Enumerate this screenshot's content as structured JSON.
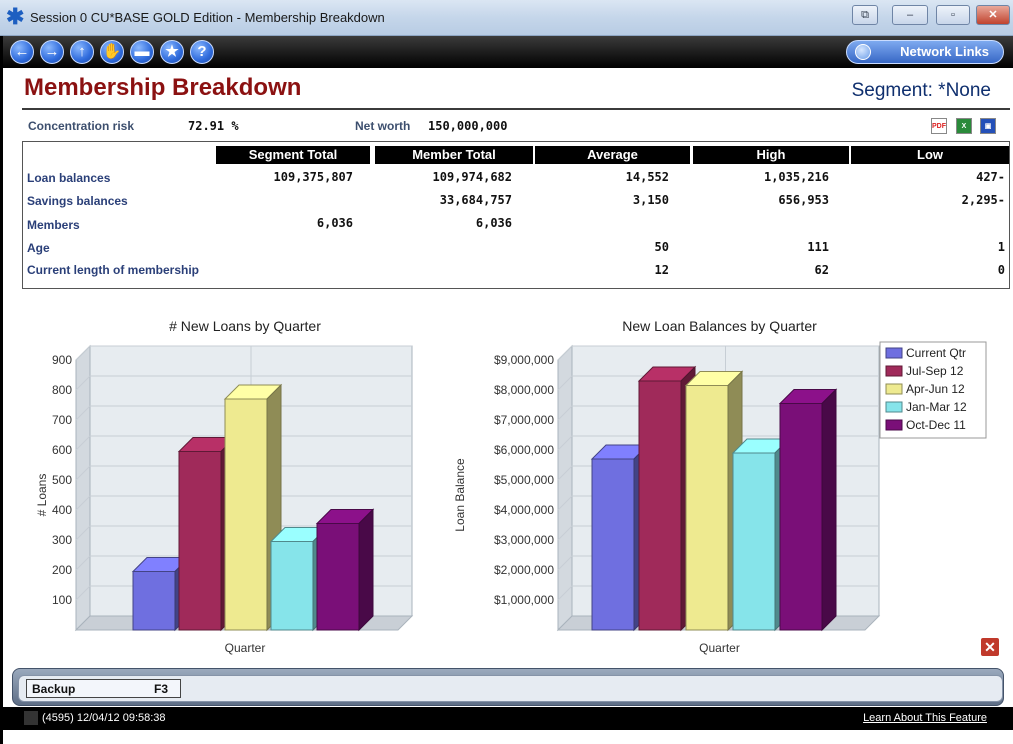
{
  "window": {
    "title": "Session 0 CU*BASE GOLD Edition - Membership Breakdown",
    "buttons": {
      "restore": "⧉",
      "minimize": "–",
      "maximize": "▫",
      "close": "✕"
    }
  },
  "toolbar": {
    "nav_icons": [
      "back-icon",
      "forward-icon",
      "up-icon",
      "hand-icon",
      "print-icon",
      "star-icon",
      "help-icon"
    ],
    "nav_glyphs": [
      "←",
      "→",
      "↑",
      "✋",
      "▬",
      "★",
      "?"
    ],
    "network_links_label": "Network Links"
  },
  "header": {
    "title": "Membership Breakdown",
    "segment": "Segment: *None"
  },
  "summary": {
    "concentration_label": "Concentration risk",
    "concentration_value": "72.91 %",
    "networth_label": "Net worth",
    "networth_value": "150,000,000"
  },
  "exports": {
    "pdf": "PDF",
    "excel": "X",
    "save": "▣"
  },
  "table": {
    "columns": [
      "Segment Total",
      "Member Total",
      "Average",
      "High",
      "Low"
    ],
    "rows": [
      {
        "label": "Loan balances",
        "segment_total": "109,375,807",
        "member_total": "109,974,682",
        "average": "14,552",
        "high": "1,035,216",
        "low": "427-"
      },
      {
        "label": "Savings balances",
        "segment_total": "",
        "member_total": "33,684,757",
        "average": "3,150",
        "high": "656,953",
        "low": "2,295-"
      },
      {
        "label": "Members",
        "segment_total": "6,036",
        "member_total": "6,036",
        "average": "",
        "high": "",
        "low": ""
      },
      {
        "label": "Age",
        "segment_total": "",
        "member_total": "",
        "average": "50",
        "high": "111",
        "low": "1"
      },
      {
        "label": "Current length of membership",
        "segment_total": "",
        "member_total": "",
        "average": "12",
        "high": "62",
        "low": "0"
      }
    ]
  },
  "colors": {
    "title": "#8b1111",
    "series": [
      "#6f6fe0",
      "#a02a5a",
      "#eeea90",
      "#86e4ea",
      "#7a0f78"
    ]
  },
  "chart_data": [
    {
      "type": "bar",
      "title": "# New Loans by Quarter",
      "xlabel": "Quarter",
      "ylabel": "# Loans",
      "ylim": [
        0,
        900
      ],
      "yticks": [
        "100",
        "200",
        "300",
        "400",
        "500",
        "600",
        "700",
        "800",
        "900"
      ],
      "series": [
        {
          "name": "Current Qtr",
          "values": [
            195
          ]
        },
        {
          "name": "Jul-Sep 12",
          "values": [
            595
          ]
        },
        {
          "name": "Apr-Jun 12",
          "values": [
            770
          ]
        },
        {
          "name": "Jan-Mar 12",
          "values": [
            295
          ]
        },
        {
          "name": "Oct-Dec 11",
          "values": [
            355
          ]
        }
      ],
      "grid": true,
      "legend": "none"
    },
    {
      "type": "bar",
      "title": "New Loan Balances by Quarter",
      "xlabel": "Quarter",
      "ylabel": "Loan Balance",
      "ylim": [
        0,
        9000000
      ],
      "yticks": [
        "$1,000,000",
        "$2,000,000",
        "$3,000,000",
        "$4,000,000",
        "$5,000,000",
        "$6,000,000",
        "$7,000,000",
        "$8,000,000",
        "$9,000,000"
      ],
      "series": [
        {
          "name": "Current Qtr",
          "values": [
            5700000
          ]
        },
        {
          "name": "Jul-Sep 12",
          "values": [
            8300000
          ]
        },
        {
          "name": "Apr-Jun 12",
          "values": [
            8150000
          ]
        },
        {
          "name": "Jan-Mar 12",
          "values": [
            5900000
          ]
        },
        {
          "name": "Oct-Dec 11",
          "values": [
            7550000
          ]
        }
      ],
      "grid": true,
      "legend": "right"
    }
  ],
  "fkeys": [
    {
      "label": "Backup",
      "key": "F3"
    }
  ],
  "status": {
    "session": "(4595) 12/04/12 09:58:38",
    "learn_link": "Learn About This Feature"
  }
}
